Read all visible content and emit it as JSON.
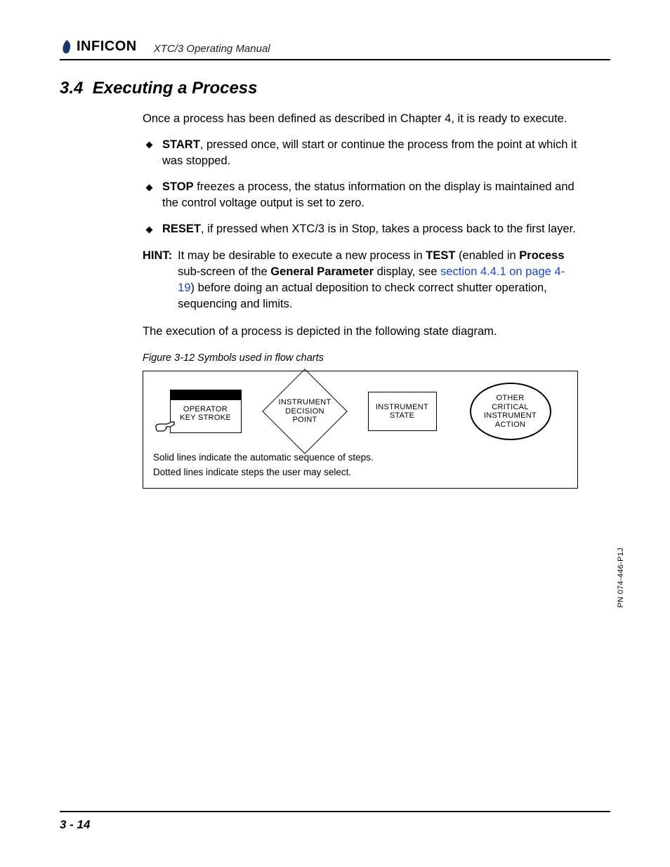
{
  "header": {
    "brand": "INFICON",
    "doc_title": "XTC/3 Operating Manual"
  },
  "section": {
    "number": "3.4",
    "title": "Executing a Process"
  },
  "intro": "Once a process has been defined as described in Chapter 4, it is ready to execute.",
  "bullets": [
    {
      "term": "START",
      "rest": ", pressed once, will start or continue the process from the point at which it was stopped."
    },
    {
      "term": "STOP",
      "rest": " freezes a process, the status information on the display is maintained and the control voltage output is set to zero."
    },
    {
      "term": "RESET",
      "rest": ", if pressed when XTC/3 is in Stop, takes a process back to the first layer."
    }
  ],
  "hint": {
    "label": "HINT:",
    "pre": "It may be desirable to execute a new process in ",
    "bold1": "TEST",
    "mid1": " (enabled in ",
    "bold2": "Process",
    "mid2": " sub-screen of the ",
    "bold3": "General Parameter",
    "mid3": " display, see ",
    "link": "section 4.4.1 on page 4-19",
    "post": ") before doing an actual deposition to check correct shutter operation, sequencing and limits."
  },
  "closing": "The execution of a process is depicted in the following state diagram.",
  "figure": {
    "caption": "Figure 3-12  Symbols used in flow charts",
    "operator": "OPERATOR\nKEY STROKE",
    "decision": "INSTRUMENT\nDECISION\nPOINT",
    "state": "INSTRUMENT\nSTATE",
    "action": "OTHER\nCRITICAL\nINSTRUMENT\nACTION",
    "note1": "Solid lines indicate the automatic sequence of steps.",
    "note2": "Dotted lines indicate steps the user may select."
  },
  "side_pn": "PN 074-446-P1J",
  "footer_page": "3 - 14"
}
